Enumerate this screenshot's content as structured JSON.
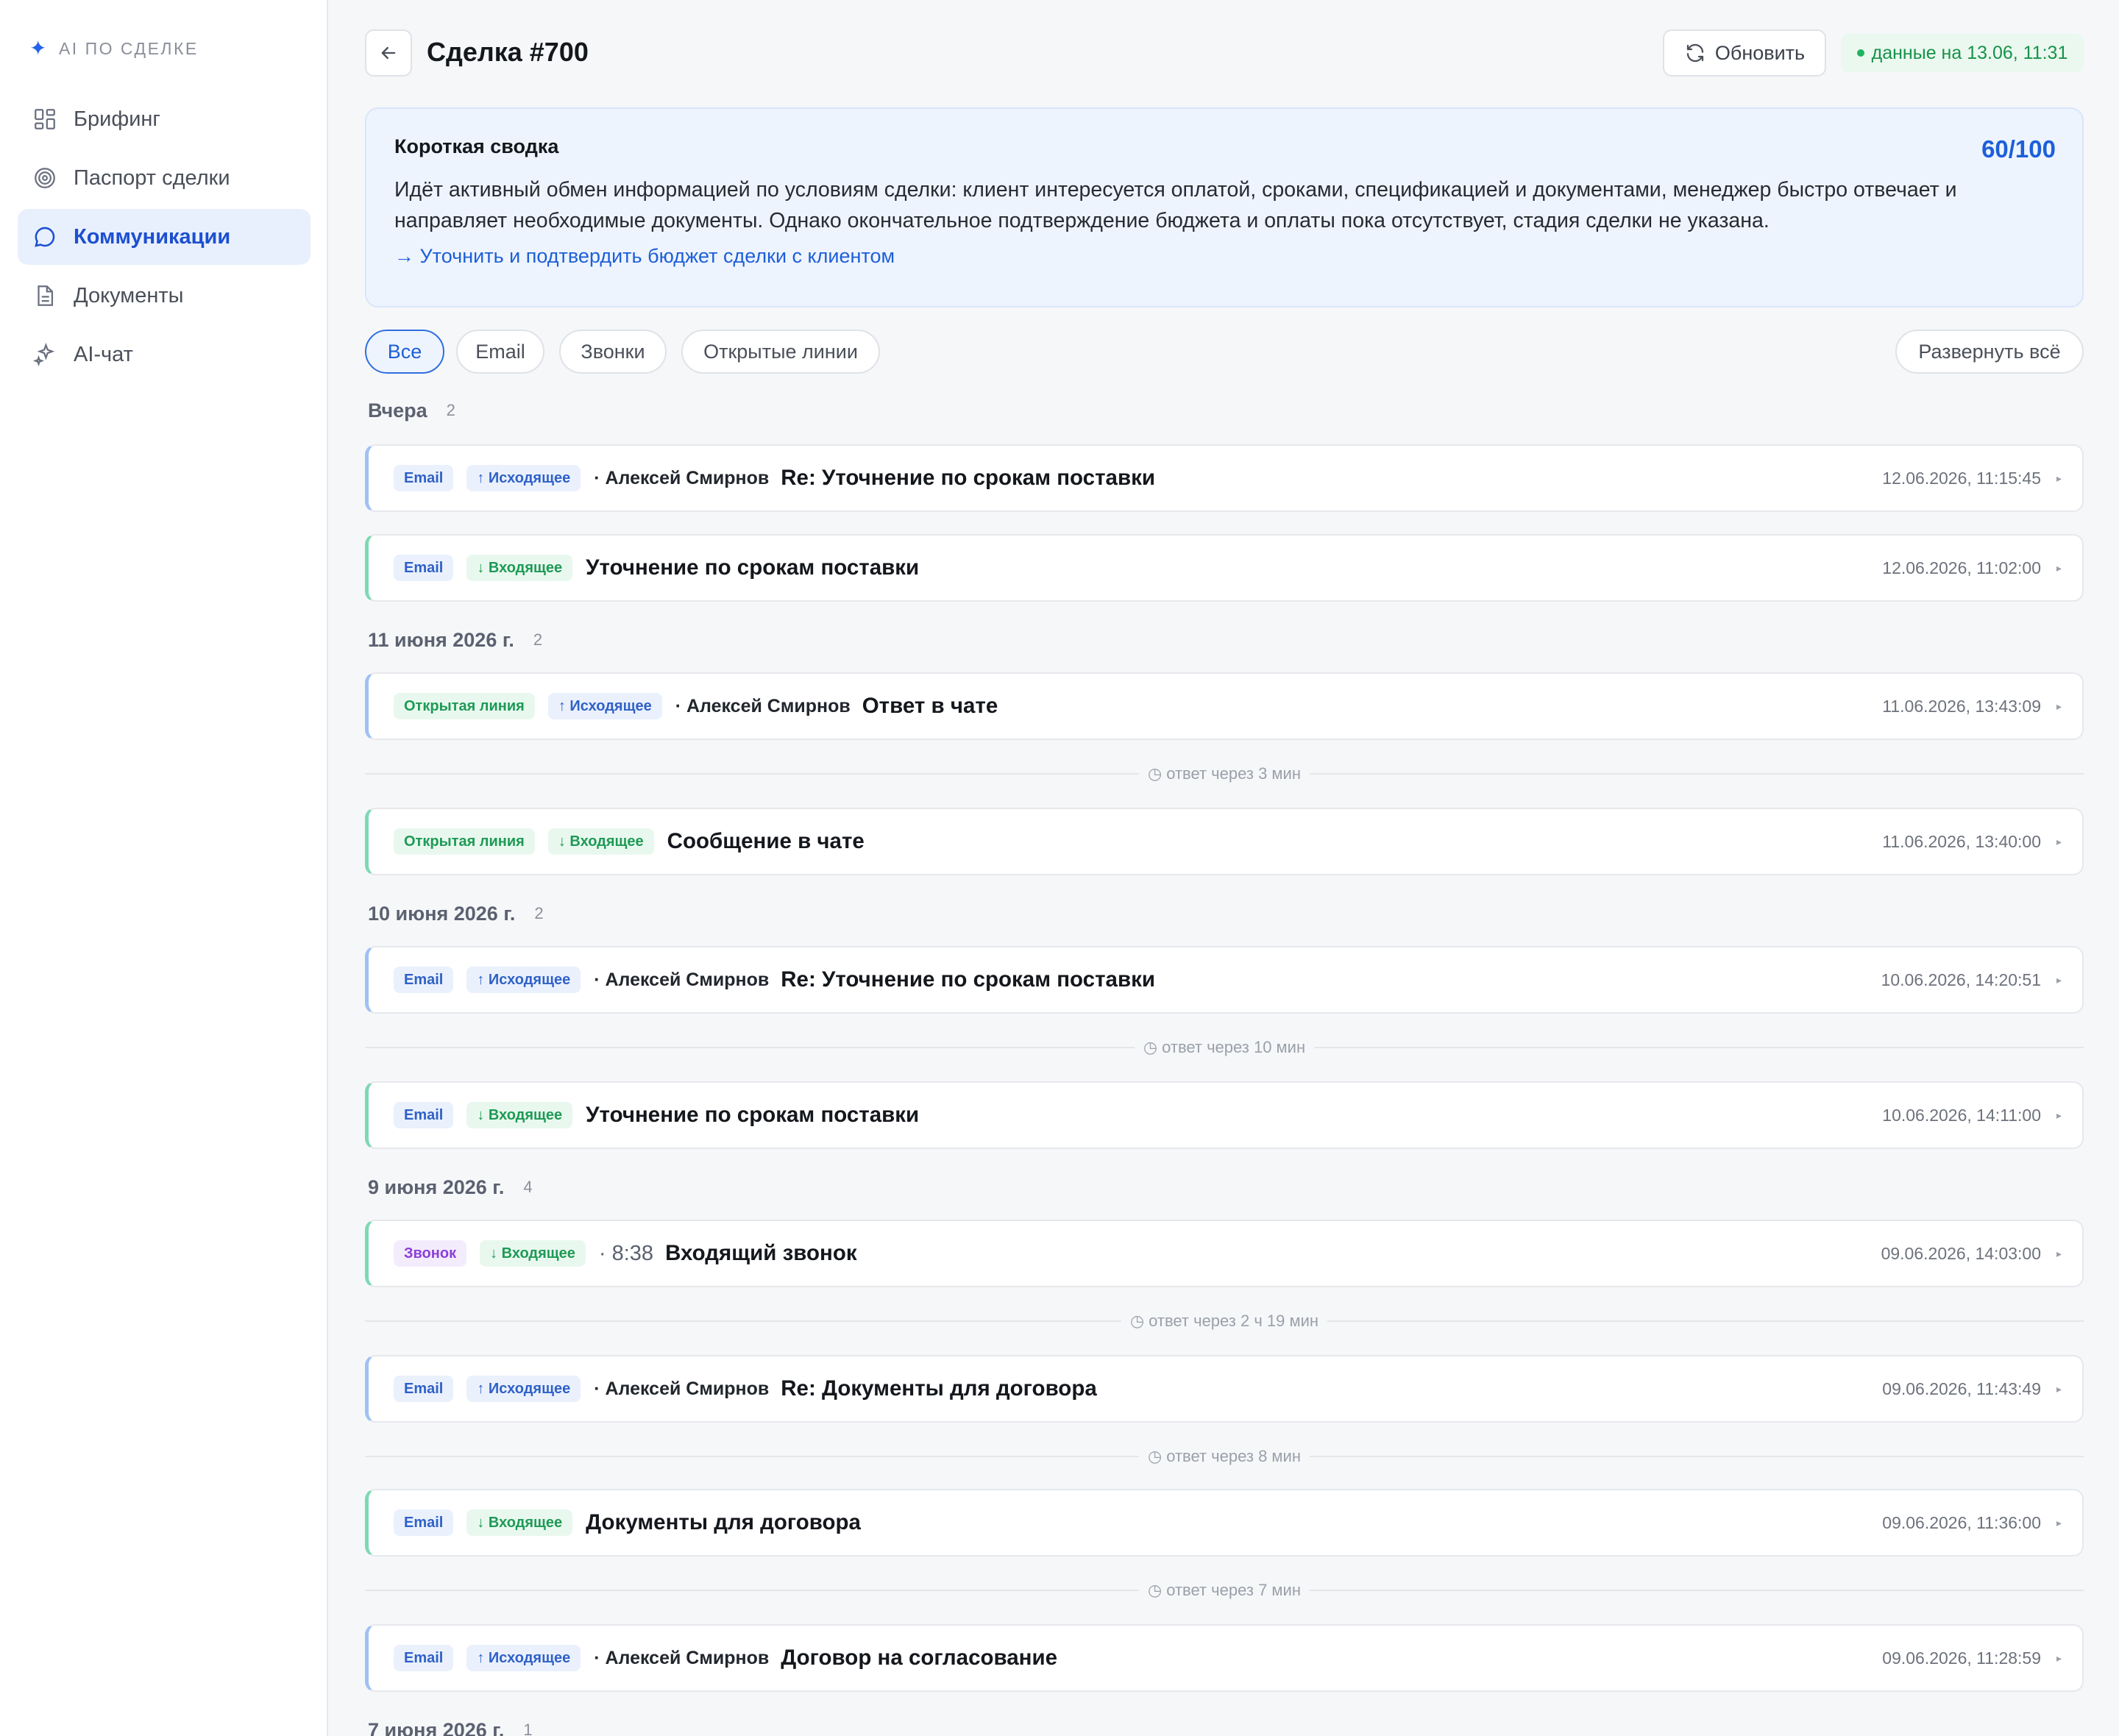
{
  "sidebar": {
    "brand": "AI ПО СДЕЛКЕ",
    "items": [
      {
        "label": "Брифинг",
        "icon": "grid-icon",
        "active": false
      },
      {
        "label": "Паспорт сделки",
        "icon": "target-icon",
        "active": false
      },
      {
        "label": "Коммуникации",
        "icon": "chat-bubble-icon",
        "active": true
      },
      {
        "label": "Документы",
        "icon": "document-icon",
        "active": false
      },
      {
        "label": "AI-чат",
        "icon": "sparkle-icon",
        "active": false
      }
    ]
  },
  "header": {
    "title": "Сделка #700",
    "refresh_label": "Обновить",
    "data_status": "данные на 13.06, 11:31"
  },
  "summary": {
    "title": "Короткая сводка",
    "score": "60/100",
    "text": "Идёт активный обмен информацией по условиям сделки: клиент интересуется оплатой, сроками, спецификацией и документами, менеджер быстро отвечает и направляет необходимые документы. Однако окончательное подтверждение бюджета и оплаты пока отсутствует, стадия сделки не указана.",
    "action": "→ Уточнить и подтвердить бюджет сделки с клиентом"
  },
  "filters": {
    "chips": [
      "Все",
      "Email",
      "Звонки",
      "Открытые линии"
    ],
    "active": "Все",
    "expand_label": "Развернуть всё"
  },
  "groups": [
    {
      "label": "Вчера",
      "count": "2"
    },
    {
      "label": "11 июня 2026 г.",
      "count": "2"
    },
    {
      "label": "10 июня 2026 г.",
      "count": "2"
    },
    {
      "label": "9 июня 2026 г.",
      "count": "4"
    },
    {
      "label": "7 июня 2026 г.",
      "count": "1"
    }
  ],
  "rows": [
    {
      "type": "Email",
      "direction": "↑ Исходящее",
      "author": "· Алексей Смирнов",
      "subject": "Re: Уточнение по срокам поставки",
      "time": "12.06.2026, 11:15:45"
    },
    {
      "type": "Email",
      "direction": "↓ Входящее",
      "subject": "Уточнение по срокам поставки",
      "time": "12.06.2026, 11:02:00"
    },
    {
      "type": "Открытая линия",
      "direction": "↑ Исходящее",
      "author": "· Алексей Смирнов",
      "subject": "Ответ в чате",
      "time": "11.06.2026, 13:43:09"
    },
    {
      "type": "Открытая линия",
      "direction": "↓ Входящее",
      "subject": "Сообщение в чате",
      "time": "11.06.2026, 13:40:00"
    },
    {
      "type": "Email",
      "direction": "↑ Исходящее",
      "author": "· Алексей Смирнов",
      "subject": "Re: Уточнение по срокам поставки",
      "time": "10.06.2026, 14:20:51"
    },
    {
      "type": "Email",
      "direction": "↓ Входящее",
      "subject": "Уточнение по срокам поставки",
      "time": "10.06.2026, 14:11:00"
    },
    {
      "type": "Звонок",
      "direction": "↓ Входящее",
      "duration": "· 8:38",
      "subject": "Входящий звонок",
      "time": "09.06.2026, 14:03:00"
    },
    {
      "type": "Email",
      "direction": "↑ Исходящее",
      "author": "· Алексей Смирнов",
      "subject": "Re: Документы для договора",
      "time": "09.06.2026, 11:43:49"
    },
    {
      "type": "Email",
      "direction": "↓ Входящее",
      "subject": "Документы для договора",
      "time": "09.06.2026, 11:36:00"
    },
    {
      "type": "Email",
      "direction": "↑ Исходящее",
      "author": "· Алексей Смирнов",
      "subject": "Договор на согласование",
      "time": "09.06.2026, 11:28:59"
    }
  ],
  "gaps": [
    "ответ через 3 мин",
    "ответ через 10 мин",
    "ответ через 2 ч 19 мин",
    "ответ через 8 мин",
    "ответ через 7 мин"
  ],
  "colors": {
    "accent": "#1d5fd8",
    "outgoing": "#9fc1f3",
    "incoming": "#7dd9b3",
    "status_green": "#17924a"
  }
}
